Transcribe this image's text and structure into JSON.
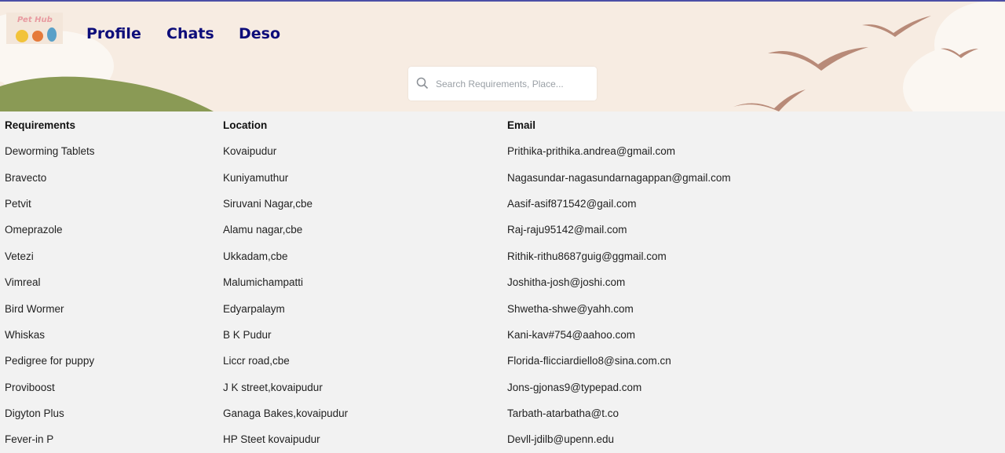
{
  "logo": {
    "text": "Pet Hub"
  },
  "nav": [
    {
      "label": "Profile"
    },
    {
      "label": "Chats"
    },
    {
      "label": "Deso"
    }
  ],
  "search": {
    "placeholder": "Search Requirements, Place..."
  },
  "table": {
    "headers": [
      "Requirements",
      "Location",
      "Email"
    ],
    "rows": [
      [
        "Deworming Tablets",
        "Kovaipudur",
        "Prithika-prithika.andrea@gmail.com"
      ],
      [
        "Bravecto",
        "Kuniyamuthur",
        "Nagasundar-nagasundarnagappan@gmail.com"
      ],
      [
        "Petvit",
        "Siruvani Nagar,cbe",
        "Aasif-asif871542@gail.com"
      ],
      [
        "Omeprazole",
        "Alamu nagar,cbe",
        "Raj-raju95142@mail.com"
      ],
      [
        "Vetezi",
        "Ukkadam,cbe",
        "Rithik-rithu8687guig@ggmail.com"
      ],
      [
        "Vimreal",
        "Malumichampatti",
        "Joshitha-josh@joshi.com"
      ],
      [
        "Bird Wormer",
        "Edyarpalaym",
        "Shwetha-shwe@yahh.com"
      ],
      [
        "Whiskas",
        "B K Pudur",
        "Kani-kav#754@aahoo.com"
      ],
      [
        "Pedigree for puppy",
        "Liccr road,cbe",
        "Florida-flicciardiello8@sina.com.cn"
      ],
      [
        "Proviboost",
        "J K street,kovaipudur",
        "Jons-gjonas9@typepad.com"
      ],
      [
        "Digyton Plus",
        "Ganaga Bakes,kovaipudur",
        "Tarbath-atarbatha@t.co"
      ],
      [
        "Fever-in P",
        "HP Steet kovaipudur",
        "Devll-jdilb@upenn.edu"
      ]
    ]
  },
  "colors": {
    "nav_text": "#0d0d7a",
    "header_bg": "#f7ece2",
    "hill": "#8a9a55",
    "birds": "#b88a78",
    "page_bg": "#f2f2f2"
  }
}
